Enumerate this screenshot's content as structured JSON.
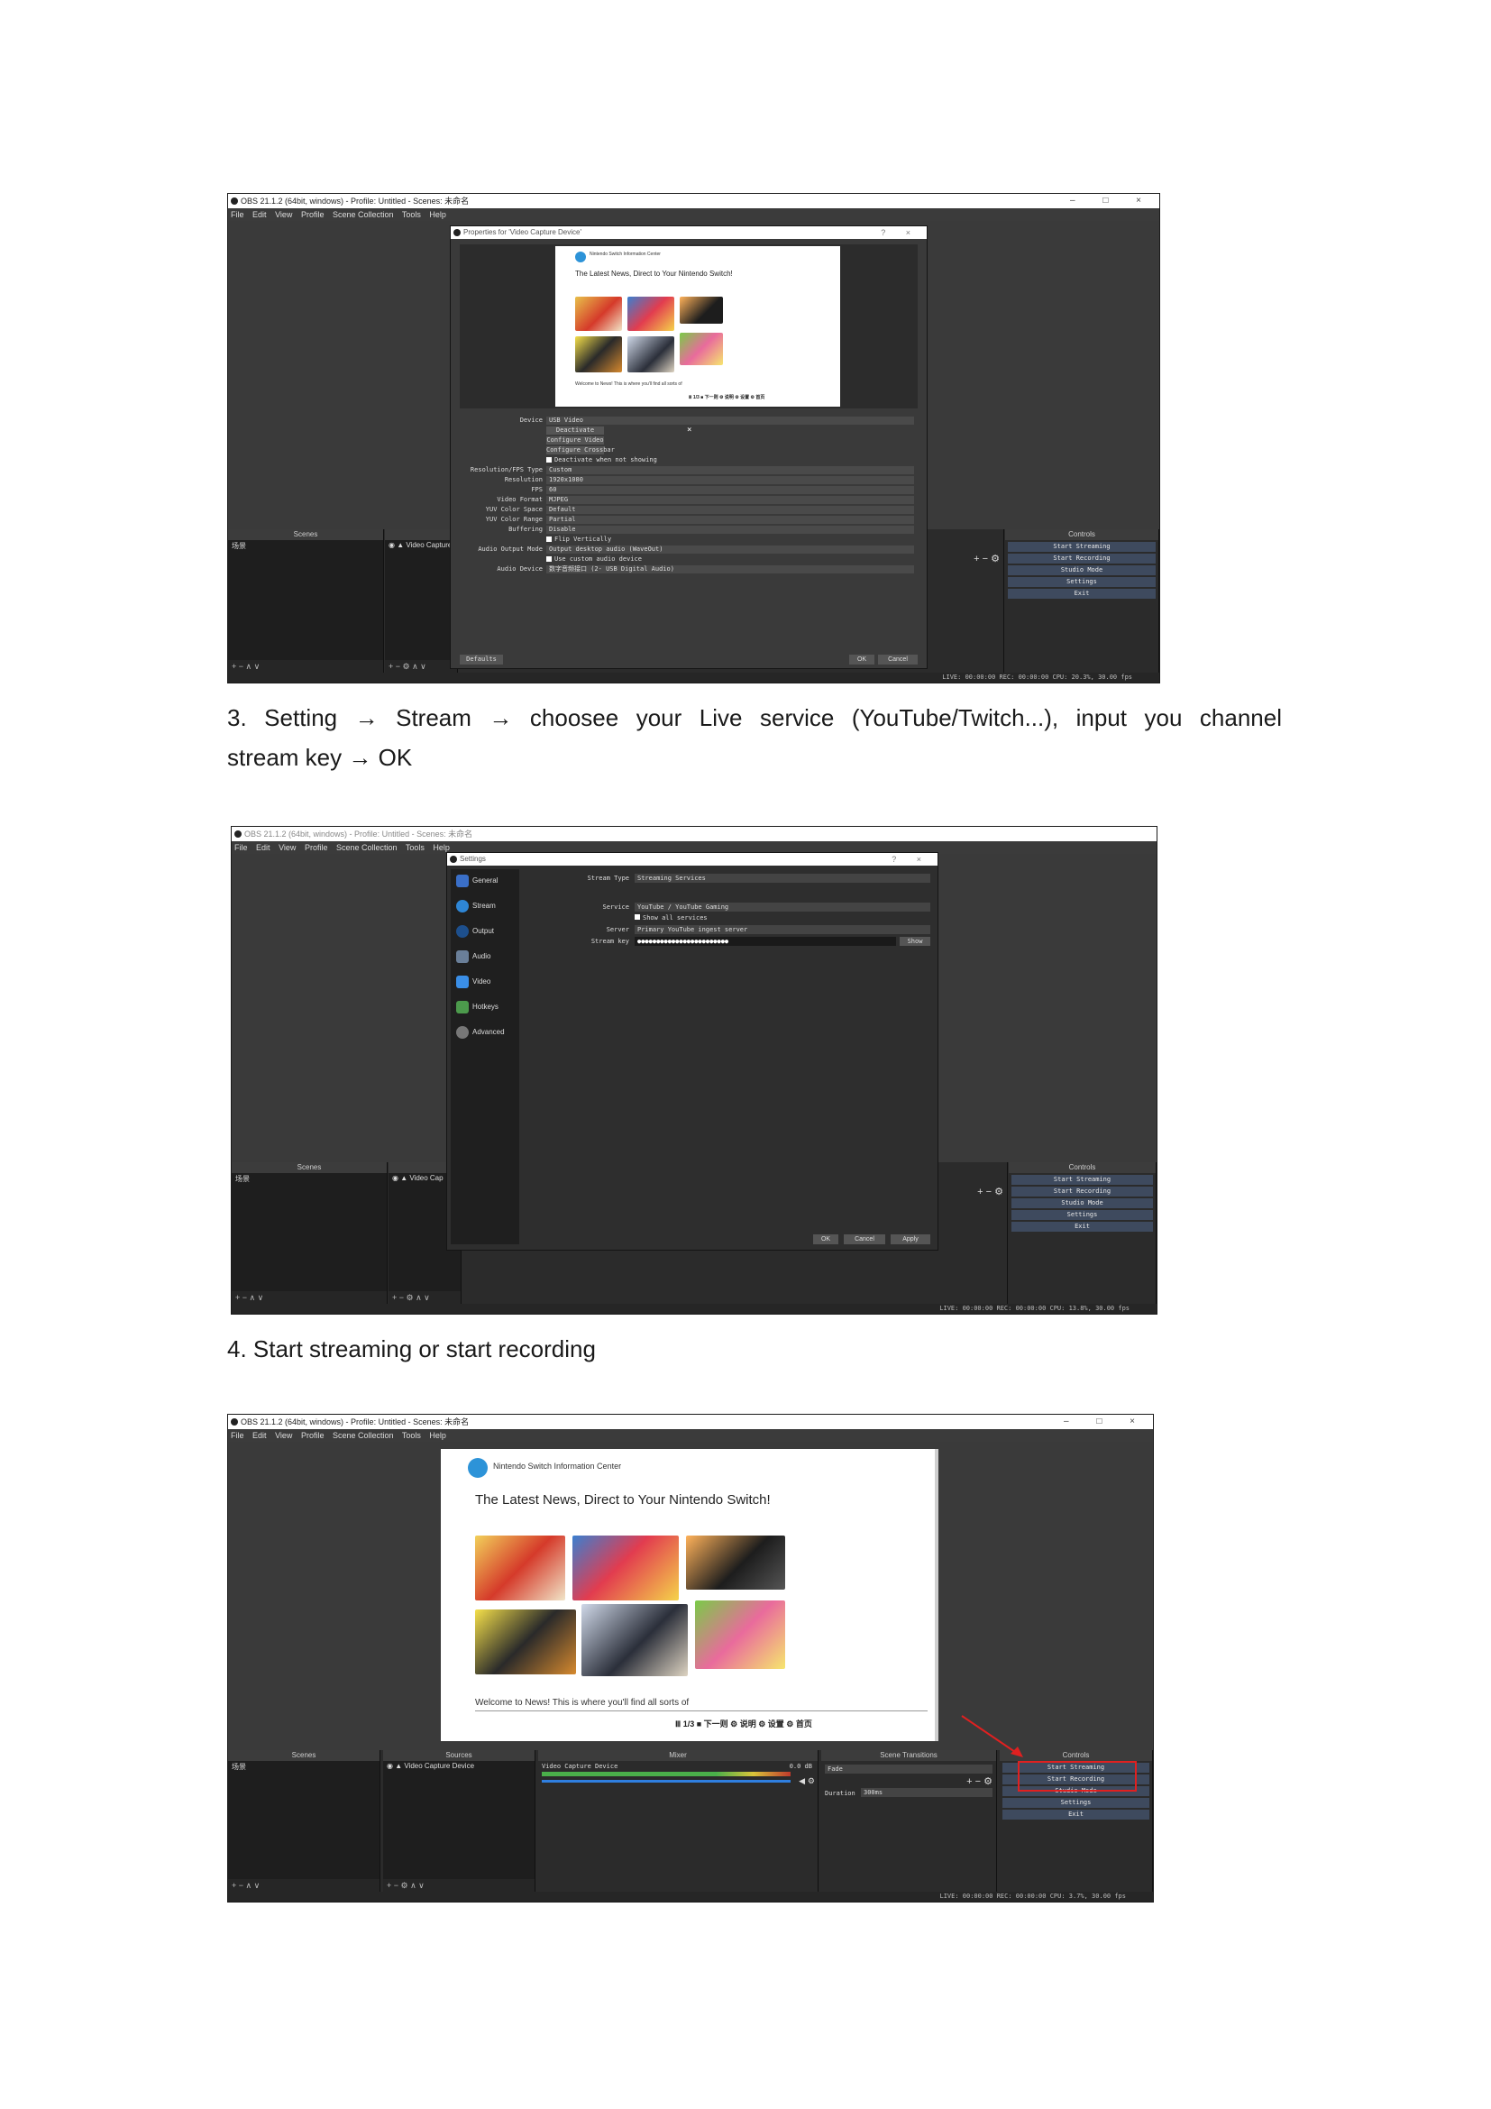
{
  "screenshot1": {
    "title": "OBS 21.1.2 (64bit, windows) - Profile: Untitled - Scenes: 未命名",
    "window_buttons": "–  □  ×",
    "menu": [
      "File",
      "Edit",
      "View",
      "Profile",
      "Scene Collection",
      "Tools",
      "Help"
    ],
    "dialog_title": "Properties for 'Video Capture Device'",
    "dialog_buttons": "?  ×",
    "web": {
      "header": "Nintendo Switch Information Center",
      "heading": "The Latest News, Direct to Your Nintendo Switch!",
      "caption": "Welcome to News! This is where you'll find all sorts of",
      "tools": "Ⅲ 1/3   ■ 下一则   ⚙ 说明   ⚙ 设置   ⚙ 首页"
    },
    "properties": [
      {
        "label": "Device",
        "value": "USB Video"
      },
      {
        "label": "",
        "button": "Deactivate"
      },
      {
        "label": "",
        "button": "Configure Video"
      },
      {
        "label": "",
        "button": "Configure Crossbar"
      },
      {
        "label": "",
        "check": "Deactivate when not showing"
      },
      {
        "label": "Resolution/FPS Type",
        "value": "Custom"
      },
      {
        "label": "Resolution",
        "value": "1920x1080"
      },
      {
        "label": "FPS",
        "value": "60"
      },
      {
        "label": "Video Format",
        "value": "MJPEG"
      },
      {
        "label": "YUV Color Space",
        "value": "Default"
      },
      {
        "label": "YUV Color Range",
        "value": "Partial"
      },
      {
        "label": "Buffering",
        "value": "Disable"
      },
      {
        "label": "",
        "check": "Flip Vertically"
      },
      {
        "label": "Audio Output Mode",
        "value": "Output desktop audio (WaveOut)"
      },
      {
        "label": "",
        "check": "Use custom audio device"
      },
      {
        "label": "Audio Device",
        "value": "数字音频接口 (2- USB Digital Audio)"
      }
    ],
    "defaults_btn": "Defaults",
    "ok_btn": "OK",
    "cancel_btn": "Cancel",
    "scenes_head": "Scenes",
    "scene_item": "场景",
    "sources_item": "◉ ▲ Video Capture",
    "controls_head": "Controls",
    "controls": [
      "Start Streaming",
      "Start Recording",
      "Studio Mode",
      "Settings",
      "Exit"
    ],
    "dock_foot": "+ − ∧ ∨",
    "sources_foot": "+ − ⚙ ∧ ∨",
    "plus_minus": "+ − ⚙",
    "status": "LIVE: 00:00:00   REC: 00:00:00   CPU: 20.3%, 30.00 fps"
  },
  "step3": "3. Setting  →  Stream  →  choosee your Live service (YouTube/Twitch...), input you channel stream key →  OK",
  "step3_line1": "3. Setting  →   Stream  →   choosee your Live service (YouTube/Twitch...), input you channel",
  "step3_line2": "stream key  →  OK",
  "screenshot2": {
    "title": "OBS 21.1.2 (64bit, windows) - Profile: Untitled - Scenes: 未命名",
    "menu": [
      "File",
      "Edit",
      "View",
      "Profile",
      "Scene Collection",
      "Tools",
      "Help"
    ],
    "dialog_title": "Settings",
    "dialog_buttons": "?  ×",
    "sidebar": [
      "General",
      "Stream",
      "Output",
      "Audio",
      "Video",
      "Hotkeys",
      "Advanced"
    ],
    "stream_type_label": "Stream Type",
    "stream_type": "Streaming Services",
    "service_label": "Service",
    "service": "YouTube / YouTube Gaming",
    "show_all": "Show all services",
    "server_label": "Server",
    "server": "Primary YouTube ingest server",
    "key_label": "Stream key",
    "key": "●●●●●●●●●●●●●●●●●●●●●●●●",
    "show_btn": "Show",
    "ok_btn": "OK",
    "cancel_btn": "Cancel",
    "apply_btn": "Apply",
    "scenes_head": "Scenes",
    "scene_item": "场景",
    "sources_item": "◉ ▲ Video Cap",
    "controls_head": "Controls",
    "controls": [
      "Start Streaming",
      "Start Recording",
      "Studio Mode",
      "Settings",
      "Exit"
    ],
    "dock_foot": "+ − ∧ ∨",
    "sources_foot": "+ − ⚙ ∧ ∨",
    "plus_minus": "+ − ⚙",
    "status": "LIVE: 00:00:00   REC: 00:00:00   CPU: 13.8%, 30.00 fps"
  },
  "step4": "4. Start streaming or start recording",
  "screenshot3": {
    "title": "OBS 21.1.2 (64bit, windows) - Profile: Untitled - Scenes: 未命名",
    "window_buttons": "–  □  ×",
    "menu": [
      "File",
      "Edit",
      "View",
      "Profile",
      "Scene Collection",
      "Tools",
      "Help"
    ],
    "web": {
      "header": "Nintendo Switch Information Center",
      "heading": "The Latest News, Direct to Your Nintendo Switch!",
      "caption": "Welcome to News! This is where you'll find all sorts of",
      "tools": "Ⅲ 1/3    ■ 下一则    ⚙ 说明    ⚙ 设置    ⚙ 首页"
    },
    "scenes_head": "Scenes",
    "sources_head": "Sources",
    "mixer_head": "Mixer",
    "transitions_head": "Scene Transitions",
    "controls_head": "Controls",
    "scene_item": "场景",
    "sources_item": "◉ ▲ Video Capture Device",
    "mixer_item": "Video Capture Device",
    "mixer_db": "0.0 dB",
    "transition_value": "Fade",
    "duration_label": "Duration",
    "duration_value": "300ms",
    "controls": [
      "Start Streaming",
      "Start Recording",
      "Studio Mode",
      "Settings",
      "Exit"
    ],
    "dock_foot": "+ − ∧ ∨",
    "sources_foot": "+ − ⚙ ∧ ∨",
    "plus_minus": "+ − ⚙",
    "status": "LIVE: 00:00:00   REC: 00:00:00   CPU: 3.7%, 30.00 fps"
  },
  "colors": {
    "accent_red": "#e02020",
    "obs_dark": "#2a2a2a",
    "button_blue": "#3e4a5e"
  }
}
